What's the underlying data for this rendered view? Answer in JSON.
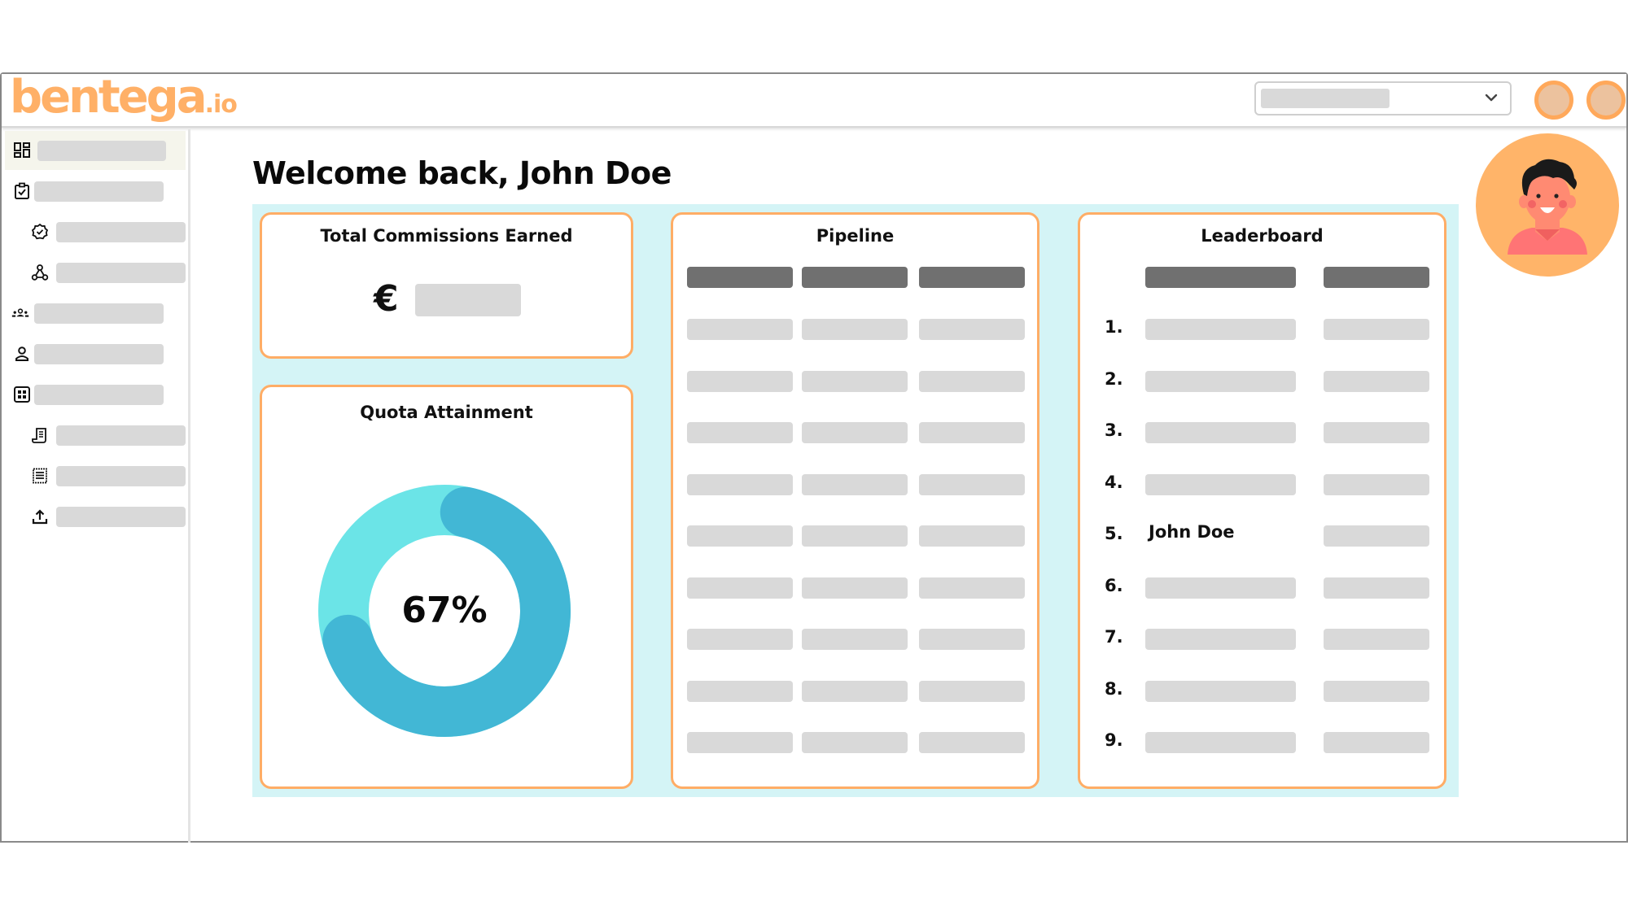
{
  "app": {
    "logo_main": "bentega",
    "logo_tld": ".io"
  },
  "header": {
    "dropdown": {
      "selected_value": "",
      "icon": "chevron-down-icon"
    },
    "circle_buttons": [
      "user-menu-button",
      "notifications-button"
    ]
  },
  "sidebar": {
    "items": [
      {
        "icon": "dashboard-icon",
        "label": "",
        "active": true,
        "indent": 0
      },
      {
        "icon": "clipboard-check-icon",
        "label": "",
        "active": false,
        "indent": 0
      },
      {
        "icon": "verified-badge-icon",
        "label": "",
        "active": false,
        "indent": 1
      },
      {
        "icon": "hierarchy-icon",
        "label": "",
        "active": false,
        "indent": 1
      },
      {
        "icon": "team-icon",
        "label": "",
        "active": false,
        "indent": 0
      },
      {
        "icon": "person-icon",
        "label": "",
        "active": false,
        "indent": 0
      },
      {
        "icon": "grid-icon",
        "label": "",
        "active": false,
        "indent": 0
      },
      {
        "icon": "receipt-icon",
        "label": "",
        "active": false,
        "indent": 1
      },
      {
        "icon": "document-list-icon",
        "label": "",
        "active": false,
        "indent": 1
      },
      {
        "icon": "upload-icon",
        "label": "",
        "active": false,
        "indent": 1
      }
    ]
  },
  "main": {
    "title": "Welcome back, John Doe",
    "commissions": {
      "title": "Total Commissions Earned",
      "currency": "€",
      "amount": ""
    },
    "quota": {
      "title": "Quota Attainment",
      "percent_label": "67%",
      "value": 0.67
    },
    "pipeline": {
      "title": "Pipeline",
      "columns": [
        "",
        "",
        ""
      ],
      "row_count": 9
    },
    "leaderboard": {
      "title": "Leaderboard",
      "columns": [
        "",
        ""
      ],
      "rows": [
        {
          "rank": "1.",
          "name": "",
          "value": ""
        },
        {
          "rank": "2.",
          "name": "",
          "value": ""
        },
        {
          "rank": "3.",
          "name": "",
          "value": ""
        },
        {
          "rank": "4.",
          "name": "",
          "value": ""
        },
        {
          "rank": "5.",
          "name": "John Doe",
          "value": ""
        },
        {
          "rank": "6.",
          "name": "",
          "value": ""
        },
        {
          "rank": "7.",
          "name": "",
          "value": ""
        },
        {
          "rank": "8.",
          "name": "",
          "value": ""
        },
        {
          "rank": "9.",
          "name": "",
          "value": ""
        }
      ]
    }
  },
  "colors": {
    "brand_orange": "#ffad66",
    "panel_bg": "#d4f4f6",
    "donut_track": "#6be4e7",
    "donut_fill": "#42b7d5",
    "placeholder": "#d9d9d9",
    "placeholder_dark": "#707070"
  }
}
